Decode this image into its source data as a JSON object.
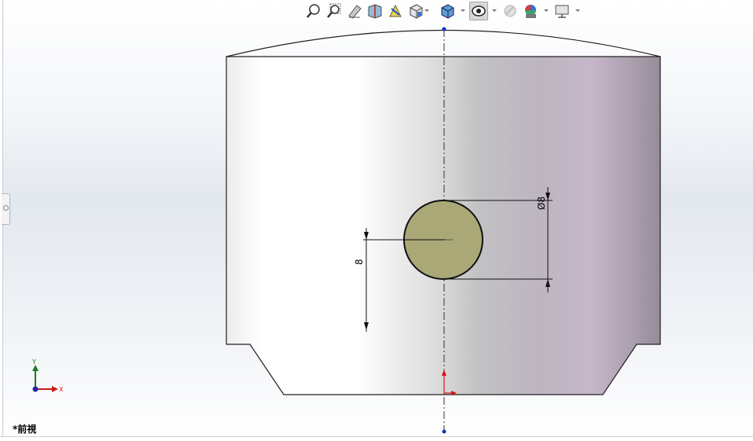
{
  "view": {
    "name": "*前視"
  },
  "dimensions": {
    "diameter": "Ø8",
    "length": "8"
  },
  "triad": {
    "y_axis": "Y",
    "x_axis": "X"
  },
  "toolbar": {
    "icons": [
      "zoom-to-fit-icon",
      "zoom-to-area-icon",
      "previous-view-icon",
      "section-view-icon",
      "dynamic-annotation-view-icon",
      "view-orientation-icon",
      "display-style-icon",
      "hide-show-items-icon",
      "edit-appearance-icon",
      "apply-scene-icon",
      "view-settings-icon"
    ]
  },
  "colors": {
    "hole_fill": "#aaa877",
    "axis_blue": "#1030c8",
    "axis_red": "#e01010",
    "axis_green": "#1a7d1a",
    "body_shade_right": "#9a8f9c"
  }
}
